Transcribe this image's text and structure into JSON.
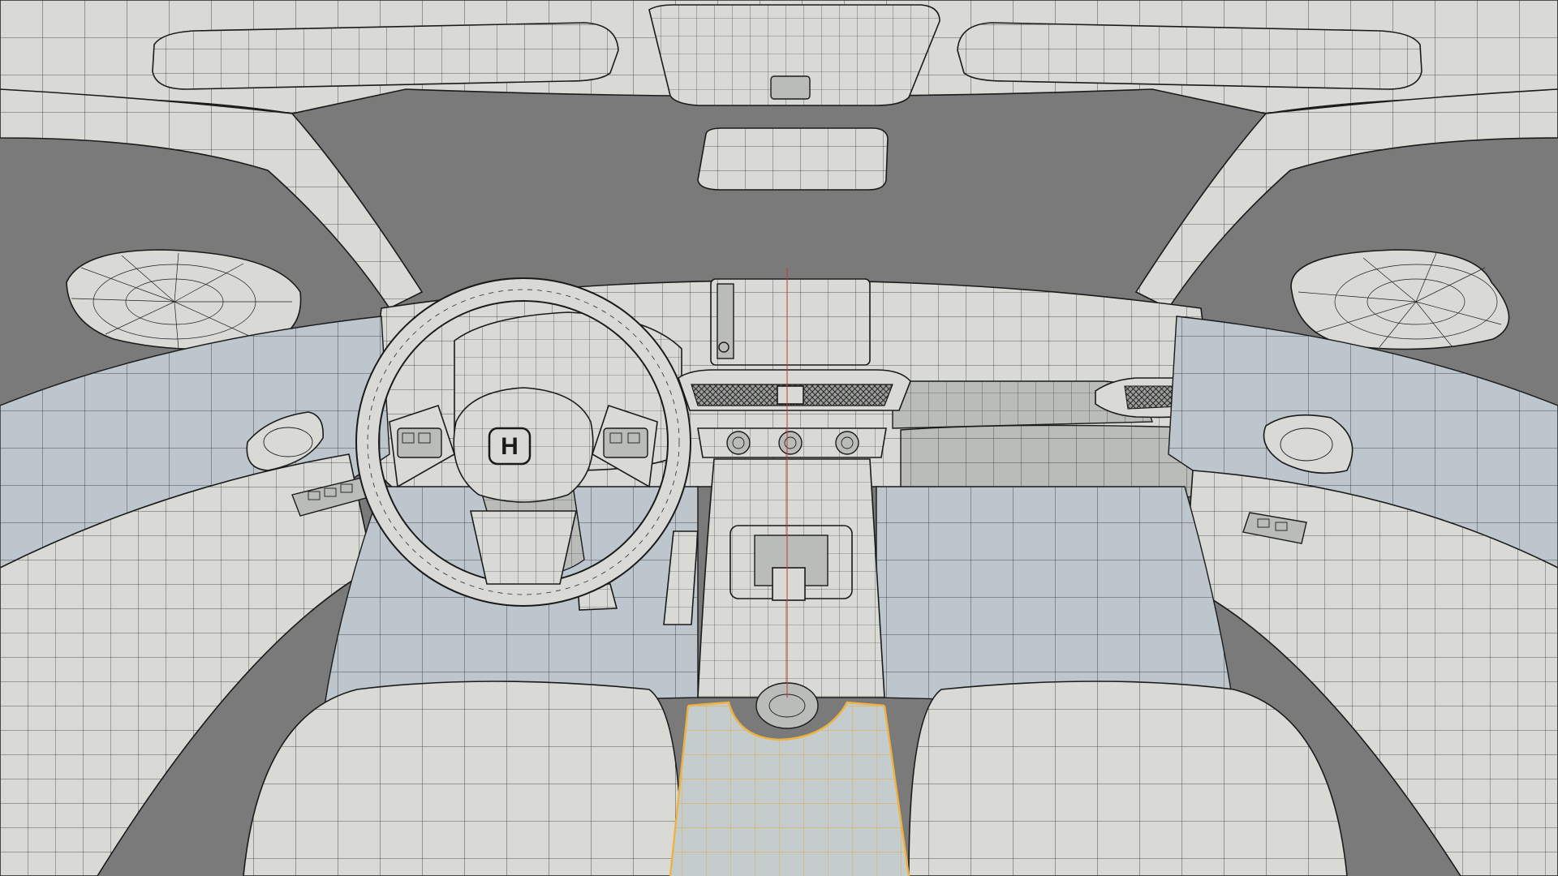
{
  "scene": {
    "background_color": "#7a7a7a",
    "surface_color": "#d9dad5",
    "wire_color": "#1e1e1e",
    "selection_color": "#f0b23e",
    "steering_emblem": "H"
  }
}
